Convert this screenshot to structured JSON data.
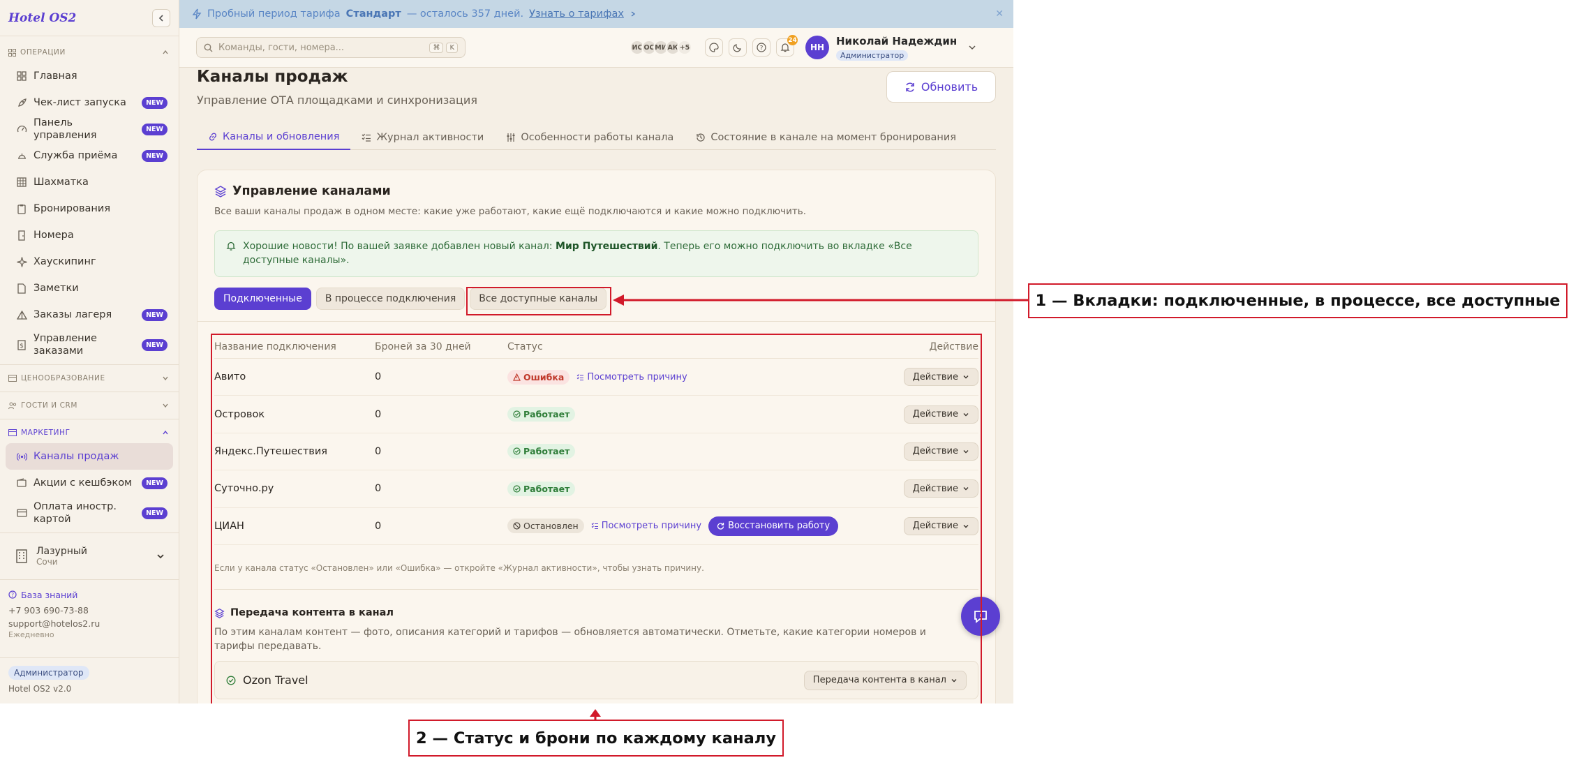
{
  "sidebar": {
    "brand": "Hotel OS2",
    "sections": {
      "operations": "ОПЕРАЦИИ",
      "pricing": "ЦЕНООБРАЗОВАНИЕ",
      "guests": "ГОСТИ И CRM",
      "marketing": "МАРКЕТИНГ"
    },
    "items": [
      {
        "label": "Главная",
        "icon": "grid-icon"
      },
      {
        "label": "Чек-лист запуска",
        "badge": "NEW",
        "icon": "rocket-icon"
      },
      {
        "label": "Панель управления",
        "badge": "NEW",
        "icon": "gauge-icon"
      },
      {
        "label": "Служба приёма",
        "badge": "NEW",
        "icon": "bell-desk-icon"
      },
      {
        "label": "Шахматка",
        "icon": "table-icon"
      },
      {
        "label": "Бронирования",
        "icon": "clipboard-icon"
      },
      {
        "label": "Номера",
        "icon": "door-icon"
      },
      {
        "label": "Хаускипинг",
        "icon": "sparkle-icon"
      },
      {
        "label": "Заметки",
        "icon": "note-icon"
      },
      {
        "label": "Заказы лагеря",
        "badge": "NEW",
        "icon": "tent-icon"
      },
      {
        "label": "Управление заказами",
        "badge": "NEW",
        "icon": "dollar-file-icon"
      }
    ],
    "marketing_items": [
      {
        "label": "Каналы продаж",
        "icon": "broadcast-icon"
      },
      {
        "label": "Акции с кешбэком",
        "badge": "NEW",
        "icon": "wallet-icon"
      },
      {
        "label": "Оплата иностр. картой",
        "badge": "NEW",
        "icon": "card-icon"
      }
    ],
    "property": {
      "name": "Лазурный",
      "city": "Сочи"
    },
    "knowledge_base": "База знаний",
    "phone": "+7 903 690-73-88",
    "email": "support@hotelos2.ru",
    "hours": "Ежедневно",
    "role": "Администратор",
    "version": "Hotel OS2 v2.0"
  },
  "trial": {
    "prefix": "Пробный период тарифа",
    "plan": "Стандарт",
    "days": "— осталось 357 дней.",
    "link": "Узнать о тарифах"
  },
  "topbar": {
    "search_placeholder": "Команды, гости, номера...",
    "kbd": [
      "⌘",
      "K"
    ],
    "avatars": [
      "ИС",
      "ОС",
      "МИ",
      "АК"
    ],
    "more": "+5",
    "notif_count": "24",
    "user_initials": "НН",
    "user_name": "Николай Надеждин",
    "user_role": "Администратор"
  },
  "page": {
    "title": "Каналы продаж",
    "subtitle": "Управление ОТА площадками и синхронизация",
    "refresh": "Обновить",
    "tabs": [
      "Каналы и обновления",
      "Журнал активности",
      "Особенности работы канала",
      "Состояние в канале на момент бронирования"
    ]
  },
  "card": {
    "title": "Управление каналами",
    "subtitle": "Все ваши каналы продаж в одном месте: какие уже работают, какие ещё подключаются и какие можно подключить.",
    "notice_pre": "Хорошие новости! По вашей заявке добавлен новый канал:",
    "notice_bold": "Мир Путешествий",
    "notice_post": ". Теперь его можно подключить во вкладке «Все доступные каналы».",
    "subtabs": [
      "Подключенные",
      "В процессе подключения",
      "Все доступные каналы"
    ],
    "columns": [
      "Название подключения",
      "Броней за 30 дней",
      "Статус",
      "Действие"
    ],
    "rows": [
      {
        "name": "Авито",
        "bookings": "0",
        "status": "Ошибка",
        "status_type": "error",
        "reason": "Посмотреть причину",
        "action": "Действие"
      },
      {
        "name": "Островок",
        "bookings": "0",
        "status": "Работает",
        "status_type": "ok",
        "action": "Действие"
      },
      {
        "name": "Яндекс.Путешествия",
        "bookings": "0",
        "status": "Работает",
        "status_type": "ok",
        "action": "Действие"
      },
      {
        "name": "Суточно.ру",
        "bookings": "0",
        "status": "Работает",
        "status_type": "ok",
        "action": "Действие"
      },
      {
        "name": "ЦИАН",
        "bookings": "0",
        "status": "Остановлен",
        "status_type": "stopped",
        "reason": "Посмотреть причину",
        "restore": "Восстановить работу",
        "action": "Действие"
      }
    ],
    "hint": "Если у канала статус «Остановлен» или «Ошибка» — откройте «Журнал активности», чтобы узнать причину.",
    "content_title": "Передача контента в канал",
    "content_sub": "По этим каналам контент — фото, описания категорий и тарифов — обновляется автоматически. Отметьте, какие категории номеров и тарифы передавать.",
    "ozon_name": "Ozon Travel",
    "ozon_action": "Передача контента в канал"
  },
  "annotations": {
    "callout1": "1 — Вкладки: подключенные, в процессе, все доступные",
    "callout2": "2 — Статус и брони по каждому каналу"
  },
  "colors": {
    "accent": "#5b3fd1",
    "annotation": "#d11a2a",
    "error": "#c0392b",
    "ok": "#2e7d38"
  }
}
